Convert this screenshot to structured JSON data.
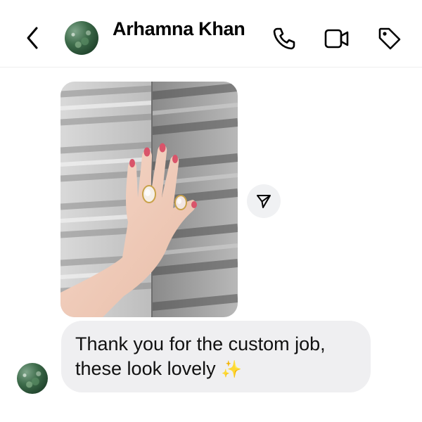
{
  "header": {
    "contact_name": "Arhamna Khan",
    "icons": [
      "back-icon",
      "phone-icon",
      "video-icon",
      "tag-icon"
    ]
  },
  "messages": [
    {
      "type": "image",
      "description_icon": "photo",
      "share_icon": "send-icon"
    },
    {
      "type": "text",
      "lines": [
        "Thank you for the custom job,",
        "these look lovely"
      ],
      "emoji": "✨"
    }
  ],
  "colors": {
    "bubble": "#efeff1",
    "share_button": "#f0f1f3",
    "nail_polish": "#d9546a"
  }
}
